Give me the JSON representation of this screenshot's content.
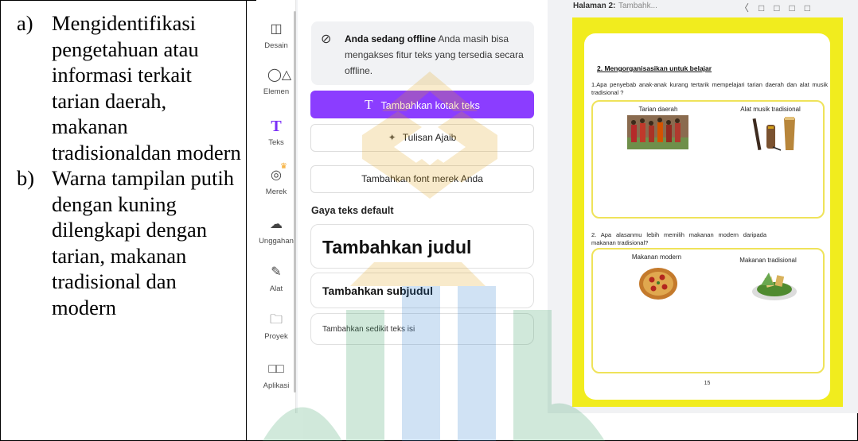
{
  "description": {
    "items": [
      {
        "marker": "a)",
        "text": "Mengidentifikasi pengetahuan atau informasi terkait tarian daerah, makanan tradisionaldan modern"
      },
      {
        "marker": "b)",
        "text": "Warna tampilan putih dengan kuning dilengkapi dengan tarian, makanan tradisional dan modern"
      }
    ]
  },
  "sidebar": {
    "items": [
      {
        "label": "Desain",
        "icon": "layout-icon"
      },
      {
        "label": "Elemen",
        "icon": "shapes-icon"
      },
      {
        "label": "Teks",
        "icon": "text-icon",
        "active": true
      },
      {
        "label": "Merek",
        "icon": "brand-icon"
      },
      {
        "label": "Unggahan",
        "icon": "upload-icon"
      },
      {
        "label": "Alat",
        "icon": "pen-icon"
      },
      {
        "label": "Proyek",
        "icon": "folder-icon"
      },
      {
        "label": "Aplikasi",
        "icon": "apps-icon"
      }
    ]
  },
  "text_panel": {
    "offline_bold": "Anda sedang offline",
    "offline_text": "Anda masih bisa mengakses fitur teks yang tersedia secara offline.",
    "add_textbox": "Tambahkan kotak teks",
    "magic_write": "Tulisan Ajaib",
    "add_brand_font": "Tambahkan font merek Anda",
    "default_styles_label": "Gaya teks default",
    "add_heading": "Tambahkan judul",
    "add_subheading": "Tambahkan subjudul",
    "add_body": "Tambahkan sedikit teks isi"
  },
  "canvas": {
    "page_label": "Halaman 2:",
    "page_name": "Tambahk..."
  },
  "worksheet": {
    "section_title": "2. Mengorganisasikan untuk belajar",
    "question1": "1.Apa penyebab anak-anak kurang tertarik mempelajari tarian daerah dan alat musik tradisional ?",
    "q1_col1": "Tarian daerah",
    "q1_col2": "Alat musik tradisional",
    "question2": "2. Apa alasanmu lebih memilih makanan modern daripada makanan tradisional?",
    "q2_col1": "Makanan modern",
    "q2_col2": "Makanan tradisional",
    "page_number": "15"
  },
  "colors": {
    "accent_purple": "#8b3dff",
    "page_yellow": "#f1ec1e",
    "box_border": "#efe35a"
  }
}
